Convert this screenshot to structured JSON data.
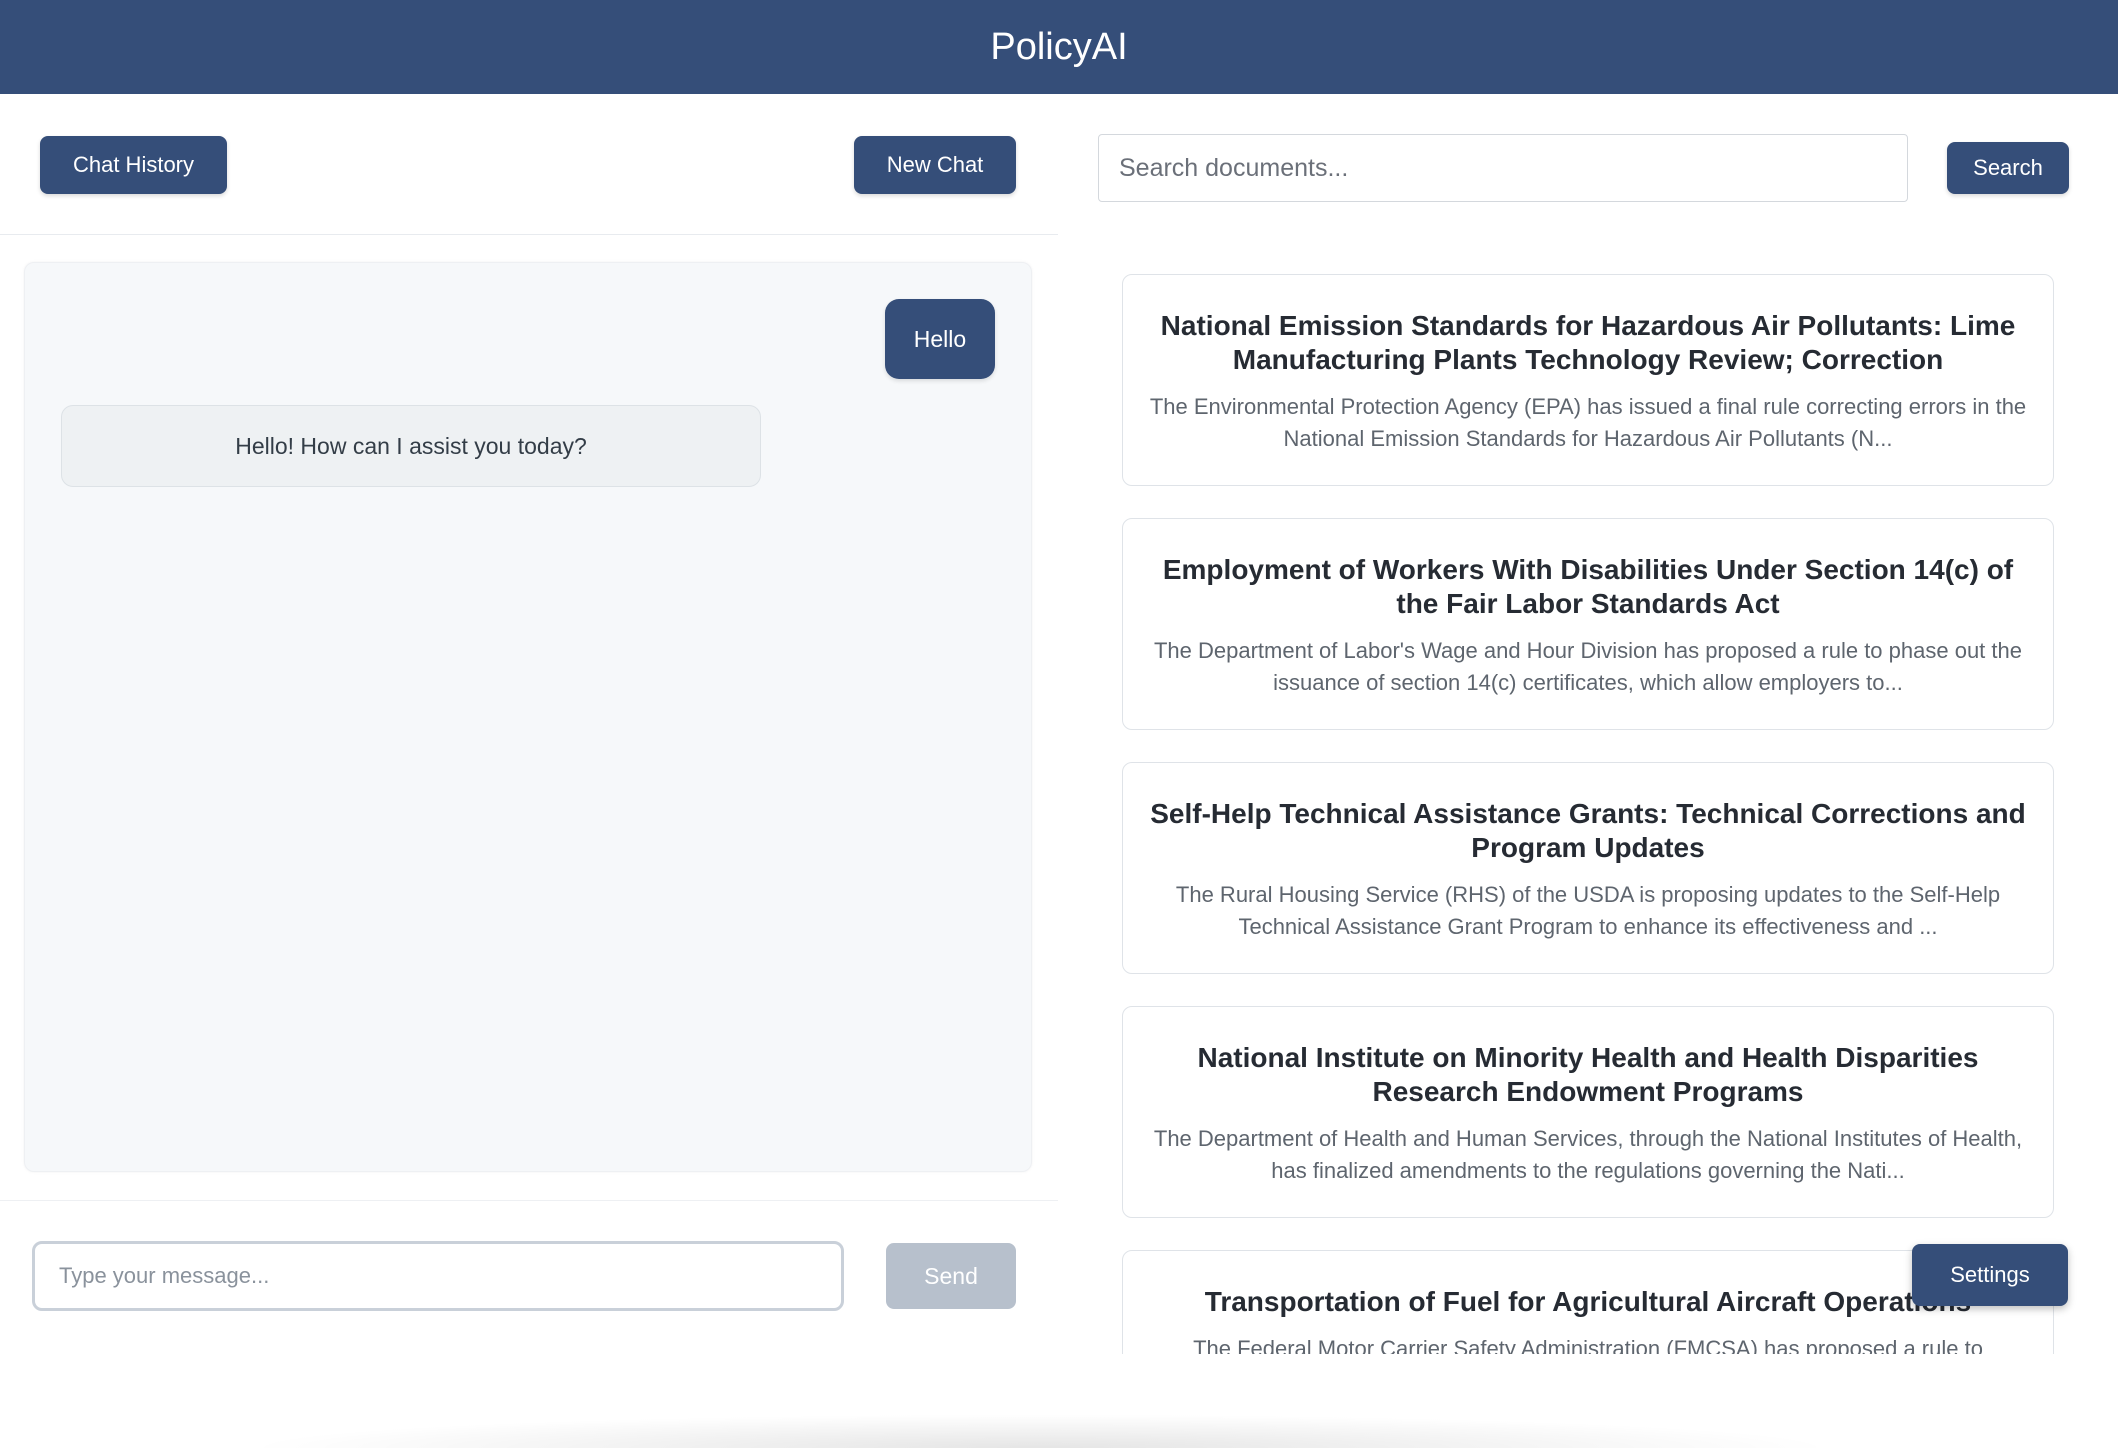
{
  "app": {
    "title": "PolicyAI"
  },
  "chat": {
    "history_label": "Chat History",
    "new_chat_label": "New Chat",
    "messages": [
      {
        "role": "user",
        "text": "Hello"
      },
      {
        "role": "assistant",
        "text": "Hello! How can I assist you today?"
      }
    ],
    "input_placeholder": "Type your message...",
    "send_label": "Send"
  },
  "search": {
    "placeholder": "Search documents...",
    "button_label": "Search"
  },
  "documents": [
    {
      "title": "National Emission Standards for Hazardous Air Pollutants: Lime Manufacturing Plants Technology Review; Correction",
      "description": "The Environmental Protection Agency (EPA) has issued a final rule correcting errors in the National Emission Standards for Hazardous Air Pollutants (N..."
    },
    {
      "title": "Employment of Workers With Disabilities Under Section 14(c) of the Fair Labor Standards Act",
      "description": "The Department of Labor's Wage and Hour Division has proposed a rule to phase out the issuance of section 14(c) certificates, which allow employers to..."
    },
    {
      "title": "Self-Help Technical Assistance Grants: Technical Corrections and Program Updates",
      "description": "The Rural Housing Service (RHS) of the USDA is proposing updates to the Self-Help Technical Assistance Grant Program to enhance its effectiveness and ..."
    },
    {
      "title": "National Institute on Minority Health and Health Disparities Research Endowment Programs",
      "description": "The Department of Health and Human Services, through the National Institutes of Health, has finalized amendments to the regulations governing the Nati..."
    },
    {
      "title": "Transportation of Fuel for Agricultural Aircraft Operations",
      "description": "The Federal Motor Carrier Safety Administration (FMCSA) has proposed a rule to"
    }
  ],
  "settings": {
    "label": "Settings"
  },
  "colors": {
    "brand": "#354e79",
    "send_disabled": "#b7c0cc"
  }
}
